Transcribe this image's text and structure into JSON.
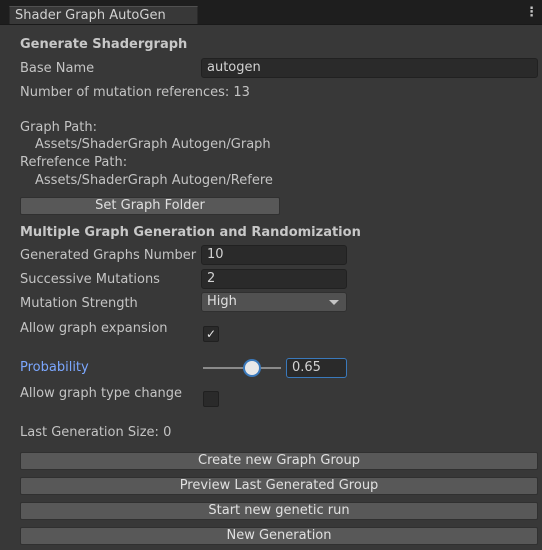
{
  "window": {
    "tab_title": "Shader Graph AutoGen",
    "menu_icon": "kebab-menu-icon"
  },
  "generate": {
    "heading": "Generate Shadergraph",
    "base_name_label": "Base Name",
    "base_name_value": "autogen",
    "mutation_refs": "Number of mutation references: 13",
    "graph_path_label": "Graph Path:",
    "graph_path_value": "Assets/ShaderGraph Autogen/Graph",
    "reference_path_label": "Refrefence Path:",
    "reference_path_value": "Assets/ShaderGraph Autogen/Refere",
    "set_folder_button": "Set Graph Folder"
  },
  "multiple": {
    "heading": "Multiple Graph Generation and Randomization",
    "graphs_number_label": "Generated Graphs Number",
    "graphs_number_value": "10",
    "successive_label": "Successive Mutations",
    "successive_value": "2",
    "strength_label": "Mutation Strength",
    "strength_value": "High",
    "expansion_label": "Allow graph expansion",
    "expansion_checked": true,
    "probability_label": "Probability",
    "probability_value": "0.65",
    "probability_fraction": 0.65,
    "type_change_label": "Allow graph type change",
    "type_change_checked": false,
    "last_size": "Last Generation Size:  0"
  },
  "actions": {
    "create_group": "Create new Graph Group",
    "preview_group": "Preview Last Generated Group",
    "start_genetic": "Start new genetic run",
    "new_generation": "New Generation"
  },
  "colors": {
    "background": "#383838",
    "accent_label": "#7ba7ff",
    "slider_thumb": "#e8e8e8",
    "focus_border": "#3a79bb"
  }
}
